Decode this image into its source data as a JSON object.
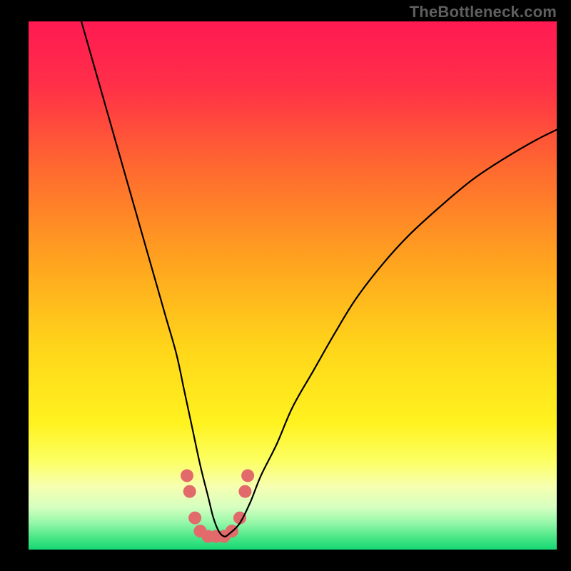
{
  "watermark": "TheBottleneck.com",
  "chart_data": {
    "type": "line",
    "title": "",
    "xlabel": "",
    "ylabel": "",
    "xlim": [
      0,
      100
    ],
    "ylim": [
      0,
      100
    ],
    "gradient_stops": [
      {
        "offset": 0.0,
        "color": "#ff1a52"
      },
      {
        "offset": 0.12,
        "color": "#ff2f48"
      },
      {
        "offset": 0.28,
        "color": "#ff6a2f"
      },
      {
        "offset": 0.45,
        "color": "#ffa21f"
      },
      {
        "offset": 0.62,
        "color": "#ffd61a"
      },
      {
        "offset": 0.76,
        "color": "#fff21f"
      },
      {
        "offset": 0.83,
        "color": "#fcff60"
      },
      {
        "offset": 0.88,
        "color": "#f7ffb0"
      },
      {
        "offset": 0.92,
        "color": "#d6ffc0"
      },
      {
        "offset": 0.95,
        "color": "#93f7a8"
      },
      {
        "offset": 0.975,
        "color": "#4fe888"
      },
      {
        "offset": 1.0,
        "color": "#16d873"
      }
    ],
    "series": [
      {
        "name": "bottleneck-curve",
        "color": "#000000",
        "width": 2.2,
        "x": [
          10,
          12,
          14,
          16,
          18,
          20,
          22,
          24,
          26,
          28,
          29.5,
          31,
          32.5,
          34,
          35,
          36,
          37,
          38,
          40,
          42,
          44,
          47,
          50,
          54,
          58,
          62,
          67,
          72,
          78,
          84,
          90,
          96,
          100
        ],
        "y": [
          100,
          93,
          86,
          79,
          72,
          65,
          58,
          51,
          44,
          37,
          30,
          23,
          16,
          10,
          6,
          3.5,
          2.5,
          3,
          5,
          9,
          14,
          20,
          27,
          34,
          41,
          47.5,
          54,
          59.5,
          65,
          70,
          74,
          77.5,
          79.5
        ]
      }
    ],
    "markers": {
      "name": "highlight-dots",
      "color": "#e26a6a",
      "radius": 9,
      "points": [
        {
          "x": 30.0,
          "y": 14
        },
        {
          "x": 30.5,
          "y": 11
        },
        {
          "x": 31.5,
          "y": 6
        },
        {
          "x": 32.5,
          "y": 3.5
        },
        {
          "x": 34.0,
          "y": 2.5
        },
        {
          "x": 35.5,
          "y": 2.5
        },
        {
          "x": 37.0,
          "y": 2.5
        },
        {
          "x": 38.5,
          "y": 3.5
        },
        {
          "x": 40.0,
          "y": 6
        },
        {
          "x": 41.0,
          "y": 11
        },
        {
          "x": 41.5,
          "y": 14
        }
      ]
    }
  }
}
